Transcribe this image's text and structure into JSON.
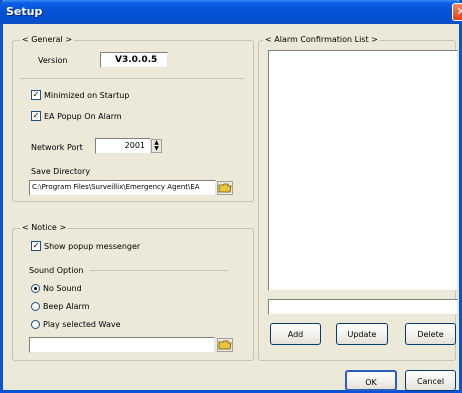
{
  "window": {
    "title": "Setup",
    "close_glyph": "✕"
  },
  "general": {
    "group_title": "< General >",
    "version_label": "Version",
    "version_value": "V3.0.0.5",
    "minimized_label": "Minimized on Startup",
    "minimized_checked": true,
    "ea_popup_label": "EA Popup On Alarm",
    "ea_popup_checked": true,
    "network_port_label": "Network Port",
    "network_port_value": "2001",
    "save_dir_label": "Save Directory",
    "save_dir_value": "C:\\Program Files\\Surveillix\\Emergency Agent\\EA"
  },
  "notice": {
    "group_title": "< Notice >",
    "show_popup_label": "Show popup messenger",
    "show_popup_checked": true,
    "sound_option_label": "Sound Option",
    "sound_options": [
      {
        "label": "No Sound",
        "selected": true
      },
      {
        "label": "Beep Alarm",
        "selected": false
      },
      {
        "label": "Play selected Wave",
        "selected": false
      }
    ],
    "wave_path_value": ""
  },
  "alarm": {
    "group_title": "< Alarm Confirmation List >",
    "entry_value": "",
    "add_label": "Add",
    "update_label": "Update",
    "delete_label": "Delete"
  },
  "footer": {
    "ok_label": "OK",
    "cancel_label": "Cancel"
  },
  "icons": {
    "close": "close-icon",
    "folder": "folder-icon",
    "spin": "spin-arrows-icon",
    "check": "check-icon"
  },
  "colors": {
    "titlebar": "#0453d5",
    "dialog_bg": "#ece9d8",
    "close_button": "#d8431c"
  }
}
